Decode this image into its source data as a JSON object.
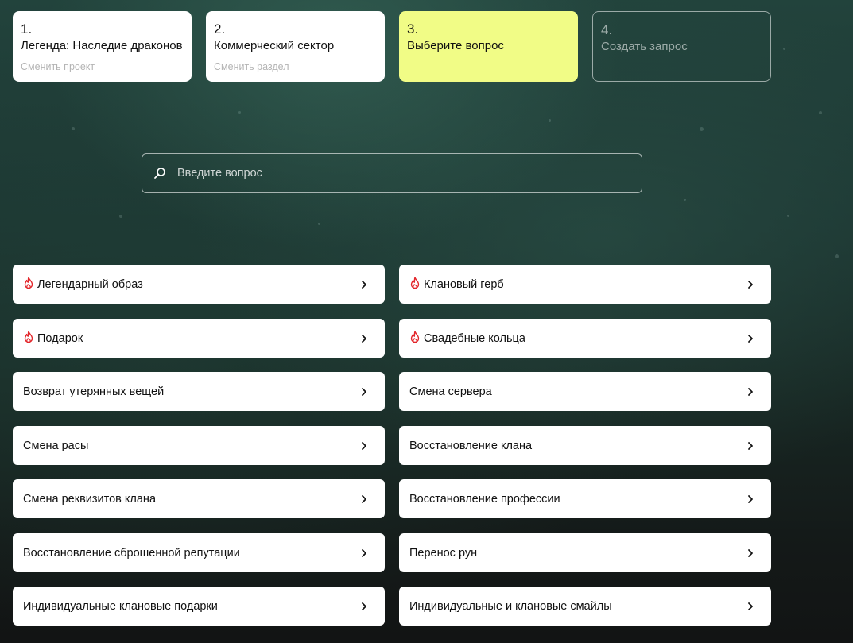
{
  "steps": [
    {
      "number": "1.",
      "title": "Легенда: Наследие драконов",
      "link": "Сменить проект"
    },
    {
      "number": "2.",
      "title": "Коммерческий сектор",
      "link": "Сменить раздел"
    },
    {
      "number": "3.",
      "title": "Выберите вопрос"
    },
    {
      "number": "4.",
      "title": "Создать запрос"
    }
  ],
  "search": {
    "placeholder": "Введите вопрос",
    "icon": "search-icon"
  },
  "questions": [
    {
      "label": "Легендарный образ",
      "hot": true
    },
    {
      "label": "Клановый герб",
      "hot": true
    },
    {
      "label": "Подарок",
      "hot": true
    },
    {
      "label": "Свадебные кольца",
      "hot": true
    },
    {
      "label": "Возврат утерянных вещей",
      "hot": false
    },
    {
      "label": "Смена сервера",
      "hot": false
    },
    {
      "label": "Смена расы",
      "hot": false
    },
    {
      "label": "Восстановление клана",
      "hot": false
    },
    {
      "label": "Смена реквизитов клана",
      "hot": false
    },
    {
      "label": "Восстановление профессии",
      "hot": false
    },
    {
      "label": "Восстановление сброшенной репутации",
      "hot": false
    },
    {
      "label": "Перенос рун",
      "hot": false
    },
    {
      "label": "Индивидуальные клановые подарки",
      "hot": false
    },
    {
      "label": "Индивидуальные и клановые смайлы",
      "hot": false
    }
  ],
  "colors": {
    "active_step": "#f1fc86",
    "hot_icon": "#e3262b",
    "card": "#ffffff"
  }
}
